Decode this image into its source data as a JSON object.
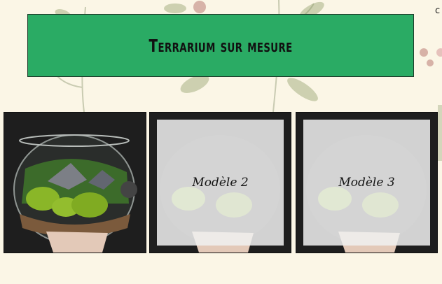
{
  "banner": {
    "title": "Terrarium sur mesure"
  },
  "corner_text": "c",
  "cards": [
    {
      "label": ""
    },
    {
      "label": "Modèle 2"
    },
    {
      "label": "Modèle 3"
    }
  ],
  "colors": {
    "banner": "#2aab64",
    "background": "#fbf6e6",
    "overlay": "#f0f0f0"
  }
}
